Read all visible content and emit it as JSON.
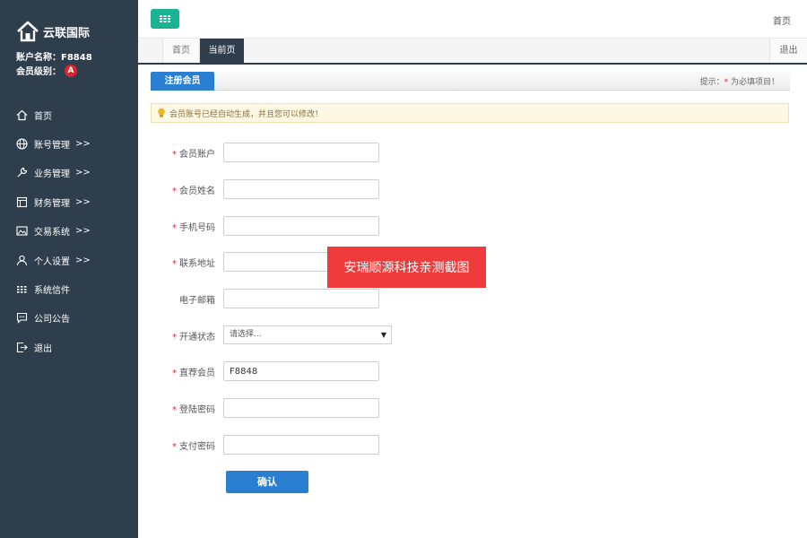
{
  "brand": {
    "name": "云联国际"
  },
  "account": {
    "name_line": "账户名称：F8848",
    "level_label": "会员级别：",
    "level_badge": "A"
  },
  "menu": [
    {
      "icon": "home-icon",
      "label": "首页",
      "arrow": ""
    },
    {
      "icon": "globe-icon",
      "label": "账号管理",
      "arrow": ">>"
    },
    {
      "icon": "wrench-icon",
      "label": "业务管理",
      "arrow": ">>"
    },
    {
      "icon": "ledger-icon",
      "label": "财务管理",
      "arrow": ">>"
    },
    {
      "icon": "picture-icon",
      "label": "交易系统",
      "arrow": ">>"
    },
    {
      "icon": "user-icon",
      "label": "个人设置",
      "arrow": ">>"
    },
    {
      "icon": "grid-icon",
      "label": "系统信件",
      "arrow": ""
    },
    {
      "icon": "chat-icon",
      "label": "公司公告",
      "arrow": ""
    },
    {
      "icon": "logout-icon",
      "label": "退出",
      "arrow": ""
    }
  ],
  "topbar": {
    "home_link": "首页"
  },
  "tabs": {
    "home": "首页",
    "current": "当前页",
    "logout": "退出"
  },
  "section": {
    "title": "注册会员",
    "tip_prefix": "提示：",
    "tip_star": "*",
    "tip_suffix": " 为必填项目！"
  },
  "notice": {
    "text": "会员账号已经自动生成，并且您可以修改！"
  },
  "form": {
    "fields": [
      {
        "label": "会员账户",
        "required": true,
        "value": ""
      },
      {
        "label": "会员姓名",
        "required": true,
        "value": ""
      },
      {
        "label": "手机号码",
        "required": true,
        "value": ""
      },
      {
        "label": "联系地址",
        "required": true,
        "value": ""
      },
      {
        "label": "电子邮箱",
        "required": false,
        "value": ""
      },
      {
        "label": "开通状态",
        "required": true,
        "type": "select",
        "value": "请选择..."
      },
      {
        "label": "直荐会员",
        "required": true,
        "value": "F8848"
      },
      {
        "label": "登陆密码",
        "required": true,
        "value": ""
      },
      {
        "label": "支付密码",
        "required": true,
        "value": ""
      }
    ],
    "submit_label": "确认"
  },
  "watermark": {
    "text": "安瑞顺源科技亲测截图"
  },
  "colors": {
    "sidebar": "#2f3e4d",
    "accent_blue": "#2a7fd1",
    "toggle_green": "#1ab394",
    "required_red": "#d9262e"
  }
}
